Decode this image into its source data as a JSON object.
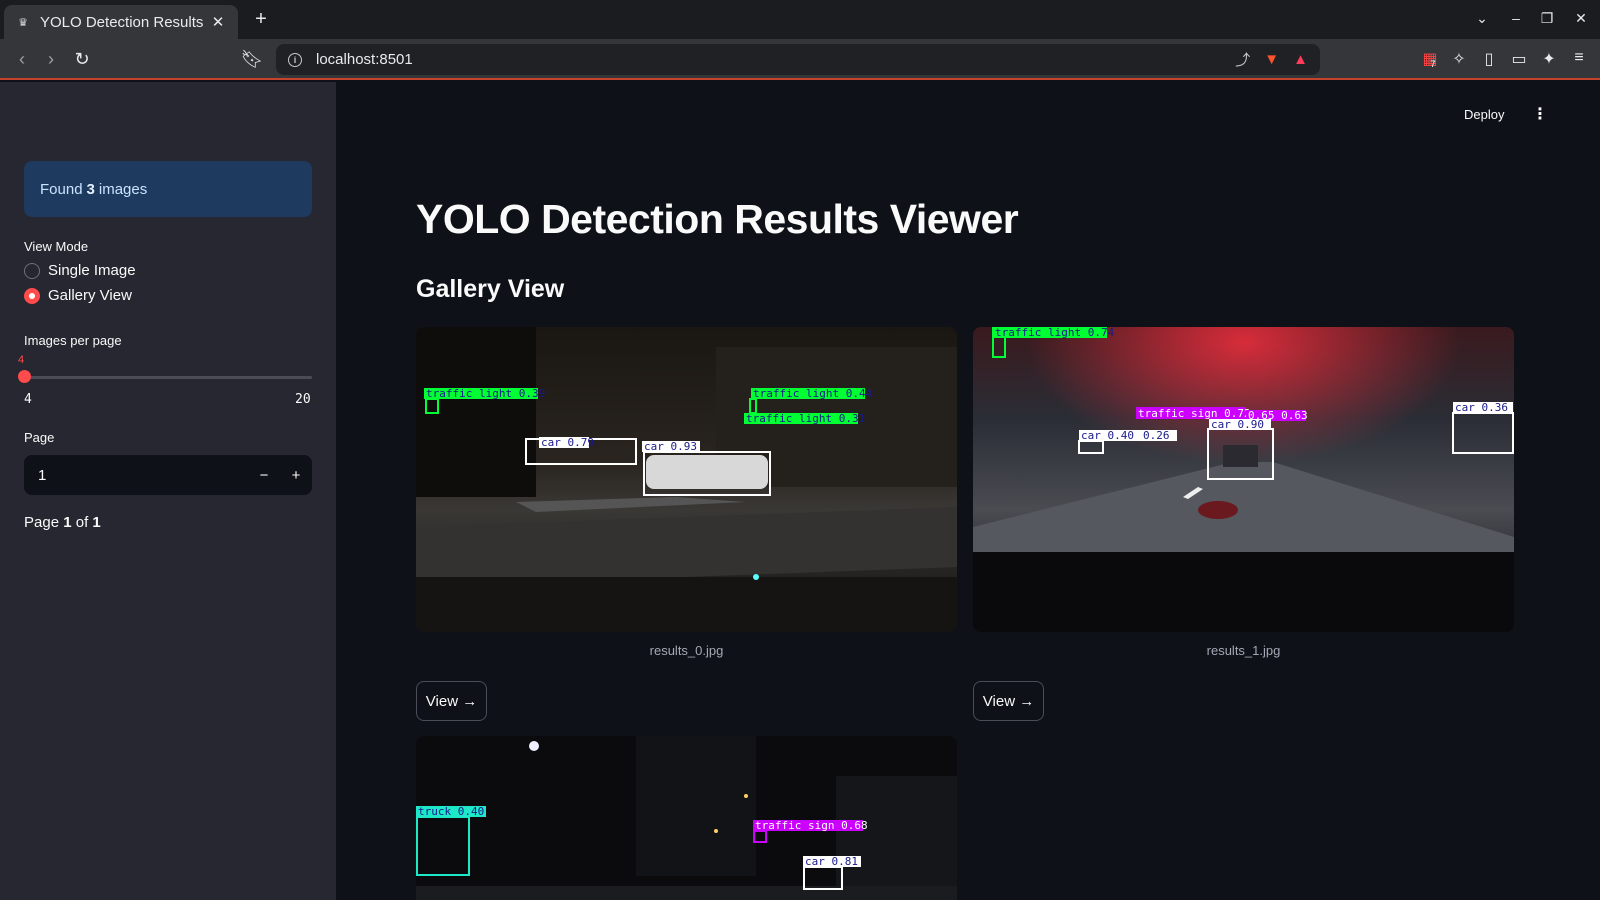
{
  "browser": {
    "tab_title": "YOLO Detection Results",
    "url": "localhost:8501",
    "extension_badge": "7"
  },
  "sidebar": {
    "found_prefix": "Found",
    "found_count": "3",
    "found_suffix": "images",
    "view_mode_label": "View Mode",
    "view_modes": [
      {
        "label": "Single Image",
        "selected": false
      },
      {
        "label": "Gallery View",
        "selected": true
      }
    ],
    "images_per_page_label": "Images per page",
    "images_per_page_value": "4",
    "slider_min": "4",
    "slider_max": "20",
    "page_label": "Page",
    "page_value": "1",
    "page_status_prefix": "Page",
    "page_current": "1",
    "page_of": "of",
    "page_total": "1"
  },
  "header": {
    "deploy_label": "Deploy"
  },
  "main": {
    "title": "YOLO Detection Results Viewer",
    "subtitle": "Gallery View",
    "view_button_label": "View →",
    "images": [
      {
        "caption": "results_0.jpg",
        "detections": [
          {
            "label": "traffic light 0.39",
            "color": "#00ff33"
          },
          {
            "label": "traffic light 0.44",
            "color": "#00ff33"
          },
          {
            "label": "traffic light 0.31",
            "color": "#00ff33"
          },
          {
            "label": "car 0.79",
            "color": "#ffffff"
          },
          {
            "label": "car 0.93",
            "color": "#ffffff"
          }
        ]
      },
      {
        "caption": "results_1.jpg",
        "detections": [
          {
            "label": "traffic light 0.74",
            "color": "#00ff33"
          },
          {
            "label": "traffic sign 0.72",
            "color": "#cc00ff"
          },
          {
            "label": "0.65 0.63",
            "color": "#cc00ff"
          },
          {
            "label": "car 0.40",
            "color": "#ffffff"
          },
          {
            "label": "0.26",
            "color": "#ffffff"
          },
          {
            "label": "car 0.90",
            "color": "#ffffff"
          },
          {
            "label": "car 0.36",
            "color": "#ffffff"
          }
        ]
      },
      {
        "caption": "",
        "detections": [
          {
            "label": "truck 0.40",
            "color": "#1de9c8"
          },
          {
            "label": "traffic sign 0.68",
            "color": "#cc00ff"
          },
          {
            "label": "car 0.81",
            "color": "#ffffff"
          }
        ]
      }
    ]
  }
}
